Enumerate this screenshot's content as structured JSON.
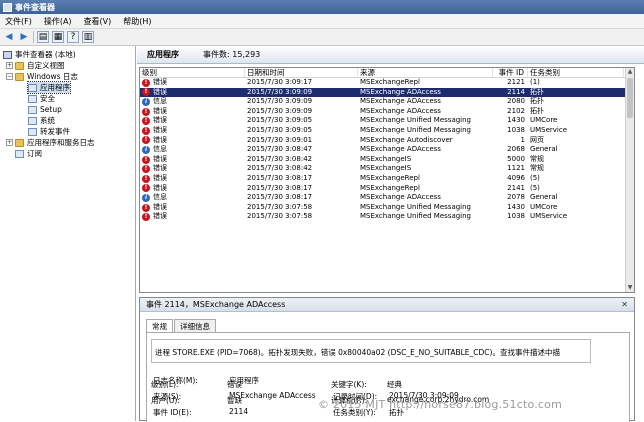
{
  "window": {
    "title": "事件查看器"
  },
  "menu": [
    "文件(F)",
    "操作(A)",
    "查看(V)",
    "帮助(H)"
  ],
  "toolbar": [
    "back-icon",
    "forward-icon",
    "up-folder-icon",
    "properties-icon",
    "help-icon",
    "show-hide-icon"
  ],
  "tree": {
    "root": "事件查看器 (本地)",
    "custom_views": "自定义视图",
    "windows_logs": "Windows 日志",
    "logs": [
      "应用程序",
      "安全",
      "Setup",
      "系统",
      "转发事件"
    ],
    "app_services": "应用程序和服务日志",
    "subscriptions": "订阅"
  },
  "main": {
    "title": "应用程序",
    "count_label": "事件数:",
    "count": "15,293"
  },
  "table": {
    "columns": [
      "级别",
      "日期和时间",
      "来源",
      "事件 ID",
      "任务类别"
    ],
    "rows": [
      {
        "level": "错误",
        "type": "err",
        "datetime": "2015/7/30 3:09:17",
        "source": "MSExchangeRepl",
        "id": "2121",
        "task": "(1)"
      },
      {
        "level": "错误",
        "type": "err",
        "datetime": "2015/7/30 3:09:09",
        "source": "MSExchange ADAccess",
        "id": "2114",
        "task": "拓扑",
        "selected": true
      },
      {
        "level": "信息",
        "type": "inf",
        "datetime": "2015/7/30 3:09:09",
        "source": "MSExchange ADAccess",
        "id": "2080",
        "task": "拓扑"
      },
      {
        "level": "错误",
        "type": "err",
        "datetime": "2015/7/30 3:09:09",
        "source": "MSExchange ADAccess",
        "id": "2102",
        "task": "拓扑"
      },
      {
        "level": "错误",
        "type": "err",
        "datetime": "2015/7/30 3:09:05",
        "source": "MSExchange Unified Messaging",
        "id": "1430",
        "task": "UMCore"
      },
      {
        "level": "错误",
        "type": "err",
        "datetime": "2015/7/30 3:09:05",
        "source": "MSExchange Unified Messaging",
        "id": "1038",
        "task": "UMService"
      },
      {
        "level": "错误",
        "type": "err",
        "datetime": "2015/7/30 3:09:01",
        "source": "MSExchange Autodiscover",
        "id": "1",
        "task": "网页"
      },
      {
        "level": "信息",
        "type": "inf",
        "datetime": "2015/7/30 3:08:47",
        "source": "MSExchange ADAccess",
        "id": "2068",
        "task": "General"
      },
      {
        "level": "错误",
        "type": "err",
        "datetime": "2015/7/30 3:08:42",
        "source": "MSExchangeIS",
        "id": "5000",
        "task": "常规"
      },
      {
        "level": "错误",
        "type": "err",
        "datetime": "2015/7/30 3:08:42",
        "source": "MSExchangeIS",
        "id": "1121",
        "task": "常规"
      },
      {
        "level": "错误",
        "type": "err",
        "datetime": "2015/7/30 3:08:17",
        "source": "MSExchangeRepl",
        "id": "4096",
        "task": "(5)"
      },
      {
        "level": "错误",
        "type": "err",
        "datetime": "2015/7/30 3:08:17",
        "source": "MSExchangeRepl",
        "id": "2141",
        "task": "(5)"
      },
      {
        "level": "信息",
        "type": "inf",
        "datetime": "2015/7/30 3:08:17",
        "source": "MSExchange ADAccess",
        "id": "2078",
        "task": "General"
      },
      {
        "level": "错误",
        "type": "err",
        "datetime": "2015/7/30 3:07:58",
        "source": "MSExchange Unified Messaging",
        "id": "1430",
        "task": "UMCore"
      },
      {
        "level": "错误",
        "type": "err",
        "datetime": "2015/7/30 3:07:58",
        "source": "MSExchange Unified Messaging",
        "id": "1038",
        "task": "UMService"
      }
    ]
  },
  "detail": {
    "header": "事件 2114，MSExchange ADAccess",
    "tabs": [
      "常规",
      "详细信息"
    ],
    "description": "进程 STORE.EXE (PID=7068)。拓扑发现失败，错误 0x80040a02 (DSC_E_NO_SUITABLE_CDC)。查找事件描述中描",
    "fields": {
      "log_name_label": "日志名称(M):",
      "log_name": "应用程序",
      "source_label": "来源(S):",
      "source": "MSExchange ADAccess",
      "logged_label": "记录时间(D):",
      "logged": "2015/7/30 3:09:09",
      "event_id_label": "事件 ID(E):",
      "event_id": "2114",
      "task_label": "任务类别(Y):",
      "task": "拓扑",
      "level_label": "级别(L):",
      "level": "错误",
      "keywords_label": "关键字(K):",
      "keywords": "经典",
      "user_label": "用户(U):",
      "user": "暂缺",
      "computer_label": "计算机(R):",
      "computer": "exchange.corp.2hydro.com"
    }
  },
  "watermark": "© 2015 MJT http://horse87.blog.51cto.com"
}
